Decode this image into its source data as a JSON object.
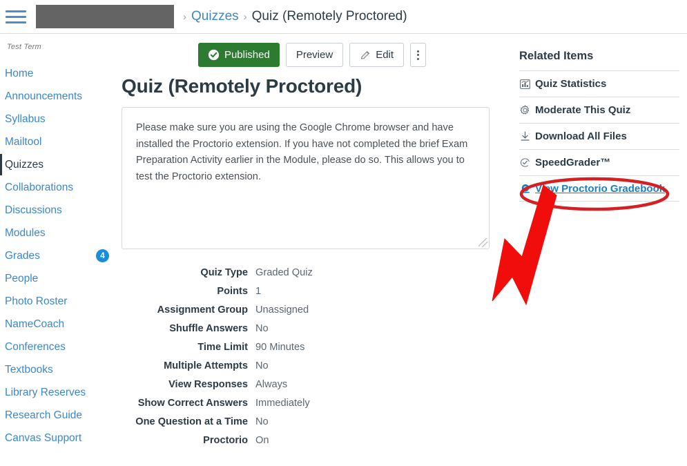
{
  "topbar": {
    "menu_icon": "hamburger-menu-icon",
    "course_name_redacted": "",
    "breadcrumb": {
      "separator": "›",
      "items": [
        {
          "label": "Quizzes",
          "link": true
        },
        {
          "label": "Quiz (Remotely Proctored)",
          "link": false
        }
      ]
    }
  },
  "sidebar": {
    "term_label": "Test Term",
    "items": [
      {
        "label": "Home",
        "active": false,
        "badge": ""
      },
      {
        "label": "Announcements",
        "active": false,
        "badge": ""
      },
      {
        "label": "Syllabus",
        "active": false,
        "badge": ""
      },
      {
        "label": "Mailtool",
        "active": false,
        "badge": ""
      },
      {
        "label": "Quizzes",
        "active": true,
        "badge": ""
      },
      {
        "label": "Collaborations",
        "active": false,
        "badge": ""
      },
      {
        "label": "Discussions",
        "active": false,
        "badge": ""
      },
      {
        "label": "Modules",
        "active": false,
        "badge": ""
      },
      {
        "label": "Grades",
        "active": false,
        "badge": "4"
      },
      {
        "label": "People",
        "active": false,
        "badge": ""
      },
      {
        "label": "Photo Roster",
        "active": false,
        "badge": ""
      },
      {
        "label": "NameCoach",
        "active": false,
        "badge": ""
      },
      {
        "label": "Conferences",
        "active": false,
        "badge": ""
      },
      {
        "label": "Textbooks",
        "active": false,
        "badge": ""
      },
      {
        "label": "Library Reserves",
        "active": false,
        "badge": ""
      },
      {
        "label": "Research Guide",
        "active": false,
        "badge": ""
      },
      {
        "label": "Canvas Support",
        "active": false,
        "badge": ""
      }
    ]
  },
  "toolbar": {
    "published_label": "Published",
    "published_icon": "check-circle-icon",
    "preview_label": "Preview",
    "edit_label": "Edit",
    "edit_icon": "pencil-icon",
    "more_icon": "kebab-menu-icon"
  },
  "quiz": {
    "title": "Quiz (Remotely Proctored)",
    "description": "Please make sure you are using the Google Chrome browser and have installed the Proctorio extension. If you have not completed the brief Exam Preparation Activity earlier in the Module, please do so. This allows you to test the Proctorio extension.",
    "details": [
      {
        "label": "Quiz Type",
        "value": "Graded Quiz"
      },
      {
        "label": "Points",
        "value": "1"
      },
      {
        "label": "Assignment Group",
        "value": "Unassigned"
      },
      {
        "label": "Shuffle Answers",
        "value": "No"
      },
      {
        "label": "Time Limit",
        "value": "90 Minutes"
      },
      {
        "label": "Multiple Attempts",
        "value": "No"
      },
      {
        "label": "View Responses",
        "value": "Always"
      },
      {
        "label": "Show Correct Answers",
        "value": "Immediately"
      },
      {
        "label": "One Question at a Time",
        "value": "No"
      },
      {
        "label": "Proctorio",
        "value": "On"
      }
    ]
  },
  "related_items": {
    "title": "Related Items",
    "items": [
      {
        "label": "Quiz Statistics",
        "icon": "bar-chart-icon",
        "highlighted": false
      },
      {
        "label": "Moderate This Quiz",
        "icon": "gear-icon",
        "highlighted": false
      },
      {
        "label": "Download All Files",
        "icon": "download-icon",
        "highlighted": false
      },
      {
        "label": "SpeedGrader™",
        "icon": "speedgrader-icon",
        "highlighted": false
      },
      {
        "label": "View Proctorio Gradebook",
        "icon": "proctorio-eye-icon",
        "highlighted": true
      }
    ]
  },
  "annotation": {
    "highlight_color": "#d61f22",
    "shapes": [
      "ellipse-highlight",
      "arrow-pointer"
    ]
  },
  "colors": {
    "link": "#3b87cd",
    "published_green": "#2d7a31",
    "badge_blue": "#1a8fd8",
    "text_dark": "#2d3b45",
    "annotation_red": "#d61f22"
  }
}
